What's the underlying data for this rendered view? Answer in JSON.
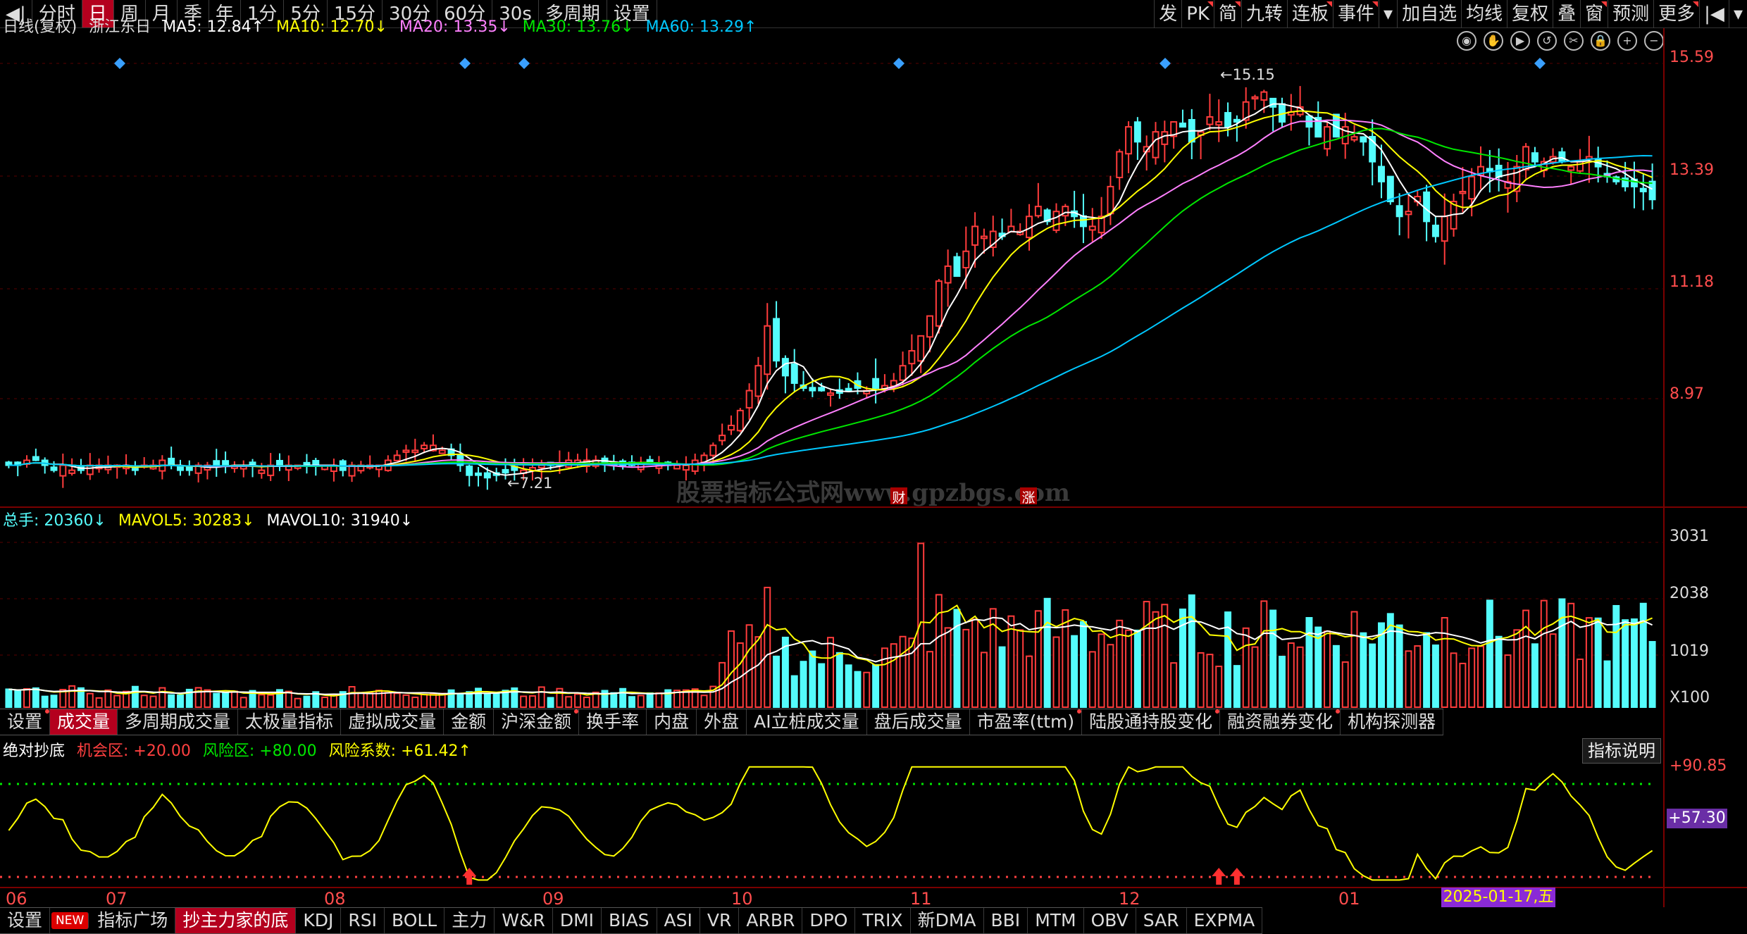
{
  "toolbar": {
    "left": [
      "分时",
      "日",
      "周",
      "月",
      "季",
      "年",
      "1分",
      "5分",
      "15分",
      "30分",
      "60分",
      "30s",
      "多周期",
      "设置"
    ],
    "right": [
      "发",
      "PK",
      "简",
      "九转",
      "连板",
      "事件",
      "加自选",
      "均线",
      "复权",
      "叠",
      "窗",
      "预测",
      "更多"
    ]
  },
  "price_legend": {
    "period": "日线(复权)",
    "name": "浙江东日",
    "ma5": "MA5: 12.84↑",
    "ma10": "MA10: 12.70↓",
    "ma20": "MA20: 13.35↓",
    "ma30": "MA30: 13.76↓",
    "ma60": "MA60: 13.29↑"
  },
  "price_axis": [
    "15.59",
    "13.39",
    "11.18",
    "8.97"
  ],
  "price_marks": {
    "high": "15.15",
    "low": "7.21",
    "watermark": "股票指标公式网www.gpzbgs.com",
    "event_cai": "财",
    "event_zhang": "涨"
  },
  "vol_legend": {
    "total": "总手: 20360↓",
    "mavol5": "MAVOL5: 30283↓",
    "mavol10": "MAVOL10: 31940↓"
  },
  "vol_axis": [
    "3031",
    "2038",
    "1019",
    "X100"
  ],
  "vol_tabs": [
    "设置",
    "成交量",
    "多周期成交量",
    "太极量指标",
    "虚拟成交量",
    "金额",
    "沪深金额",
    "换手率",
    "内盘",
    "外盘",
    "AI立桩成交量",
    "盘后成交量",
    "市盈率(ttm)",
    "陆股通持股变化",
    "融资融券变化",
    "机构探测器"
  ],
  "ind_legend": {
    "name": "绝对抄底",
    "chance": "机会区: +20.00",
    "risk": "风险区: +80.00",
    "coef": "风险系数: +61.42↑"
  },
  "ind_button": "指标说明",
  "ind_axis": {
    "top": "+90.85",
    "cur": "+57.30"
  },
  "x_labels": [
    "06",
    "07",
    "08",
    "09",
    "10",
    "11",
    "12",
    "01"
  ],
  "date_box": "2025-01-17,五",
  "bottom_tabs": [
    "设置",
    "NEW",
    "指标广场",
    "抄主力家的底",
    "KDJ",
    "RSI",
    "BOLL",
    "主力",
    "W&R",
    "DMI",
    "BIAS",
    "ASI",
    "VR",
    "ARBR",
    "DPO",
    "TRIX",
    "新DMA",
    "BBI",
    "MTM",
    "OBV",
    "SAR",
    "EXPMA"
  ],
  "colors": {
    "up": "#ff3c3c",
    "down": "#54fcfc",
    "ma5": "#ffffff",
    "ma10": "#ffff00",
    "ma20": "#ff80ff",
    "ma30": "#00e600",
    "ma60": "#00c8ff",
    "accent": "#b4001e",
    "kline_series": "reconstructed daily OHLC approx 2024-05..2025-01"
  },
  "chart_data": {
    "type": "candlestick",
    "title": "浙江东日 日线(复权)",
    "ylim": [
      6.8,
      16.0
    ],
    "closes": [
      7.5,
      7.5,
      7.6,
      7.6,
      7.5,
      7.4,
      7.5,
      7.4,
      7.4,
      7.5,
      7.5,
      7.5,
      7.5,
      7.5,
      7.4,
      7.5,
      7.5,
      7.6,
      7.5,
      7.4,
      7.4,
      7.5,
      7.5,
      7.5,
      7.5,
      7.5,
      7.5,
      7.5,
      7.4,
      7.5,
      7.5,
      7.5,
      7.5,
      7.5,
      7.5,
      7.5,
      7.5,
      7.4,
      7.5,
      7.5,
      7.5,
      7.5,
      7.6,
      7.7,
      7.8,
      7.8,
      7.9,
      7.9,
      7.8,
      7.7,
      7.5,
      7.3,
      7.3,
      7.25,
      7.3,
      7.35,
      7.4,
      7.4,
      7.45,
      7.5,
      7.5,
      7.55,
      7.6,
      7.6,
      7.6,
      7.6,
      7.55,
      7.5,
      7.5,
      7.5,
      7.55,
      7.55,
      7.5,
      7.5,
      7.5,
      7.5,
      7.6,
      7.7,
      7.9,
      8.1,
      8.3,
      8.6,
      9.0,
      9.5,
      10.3,
      9.6,
      9.3,
      9.15,
      9.05,
      9.0,
      9.0,
      8.95,
      8.95,
      9.0,
      9.05,
      9.0,
      9.05,
      9.1,
      9.2,
      9.5,
      9.8,
      10.1,
      10.5,
      11.2,
      11.5,
      11.3,
      11.8,
      12.3,
      12.1,
      12.2,
      12.1,
      12.3,
      12.2,
      12.5,
      12.7,
      12.4,
      12.6,
      12.7,
      12.5,
      12.3,
      12.3,
      12.5,
      13.1,
      13.8,
      14.3,
      14.0,
      13.9,
      14.2,
      14.2,
      14.4,
      14.3,
      14.0,
      14.2,
      14.5,
      14.4,
      14.3,
      14.4,
      14.8,
      14.9,
      15.0,
      14.7,
      14.4,
      14.6,
      14.7,
      14.3,
      14.1,
      14.3,
      14.1,
      14.3,
      14.1,
      14.0,
      13.6,
      13.2,
      12.8,
      12.5,
      12.6,
      12.9,
      12.4,
      12.1,
      12.5,
      12.8,
      13.0,
      13.3,
      13.5,
      13.4,
      13.3,
      13.2,
      13.5,
      13.9,
      13.6,
      13.6,
      13.7,
      13.6,
      13.5,
      13.6,
      13.7,
      13.5,
      13.3,
      13.2,
      13.1,
      13.1,
      13.0,
      12.84
    ],
    "ma_values": {
      "MA5": 12.84,
      "MA10": 12.7,
      "MA20": 13.35,
      "MA30": 13.76,
      "MA60": 13.29
    },
    "high_marker": 15.15,
    "low_marker": 7.21,
    "volume_ylim": [
      0,
      3200
    ],
    "volume_ticks": [
      1019,
      2038,
      3031
    ],
    "indicator_ylim": [
      15,
      95
    ],
    "indicator_lines": {
      "top": 90.85,
      "risk": 80.0,
      "chance": 20.0,
      "current": 57.3
    }
  }
}
